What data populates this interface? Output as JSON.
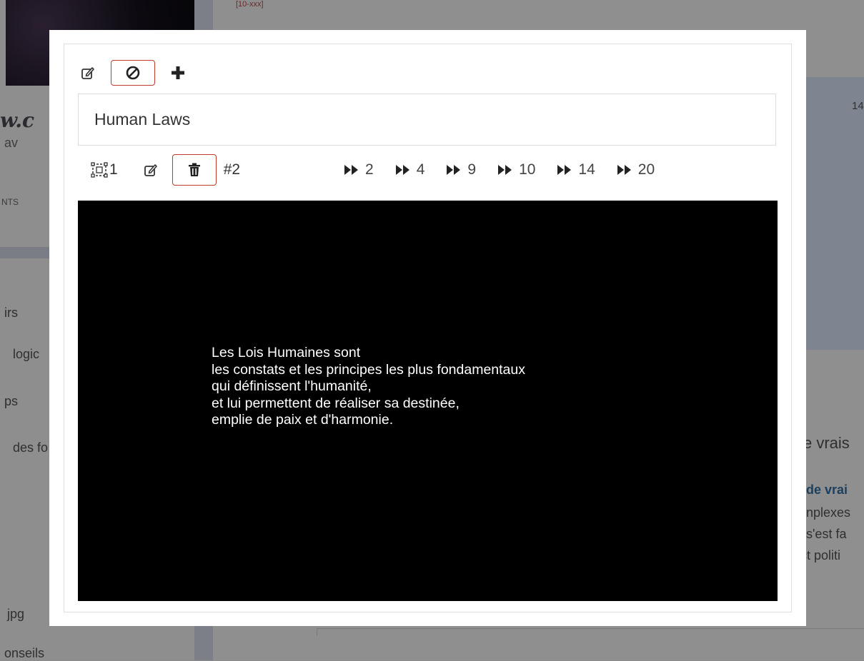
{
  "background": {
    "top_tag": "[10-xxx]",
    "brand_fragment": "w.c",
    "left_sub": "av",
    "left_caps": "NTS",
    "menu": [
      "irs",
      "logic",
      "ps",
      "des fo"
    ],
    "file_item": "jpg",
    "bottom_item": "onseils",
    "right_number": "14",
    "right_heading": "e vrais",
    "right_link": "de vrai",
    "right_lines": [
      "nplexes",
      "s'est fa",
      "ct politi"
    ]
  },
  "toolbar": {
    "edit_icon": "edit-icon",
    "cancel_icon": "ban-icon",
    "add_icon": "plus-icon"
  },
  "title": "Human Laws",
  "slide_bar": {
    "slide_count": "1",
    "slide_id": "#2",
    "jumps": [
      {
        "label": "2"
      },
      {
        "label": "4"
      },
      {
        "label": "9"
      },
      {
        "label": "10"
      },
      {
        "label": "14"
      },
      {
        "label": "20"
      }
    ]
  },
  "slide": {
    "lines": [
      "Les Lois Humaines sont",
      "les constats et les principes les plus fondamentaux",
      "qui définissent l'humanité,",
      "et lui permettent de réaliser sa destinée,",
      "emplie de paix et d'harmonie."
    ]
  }
}
